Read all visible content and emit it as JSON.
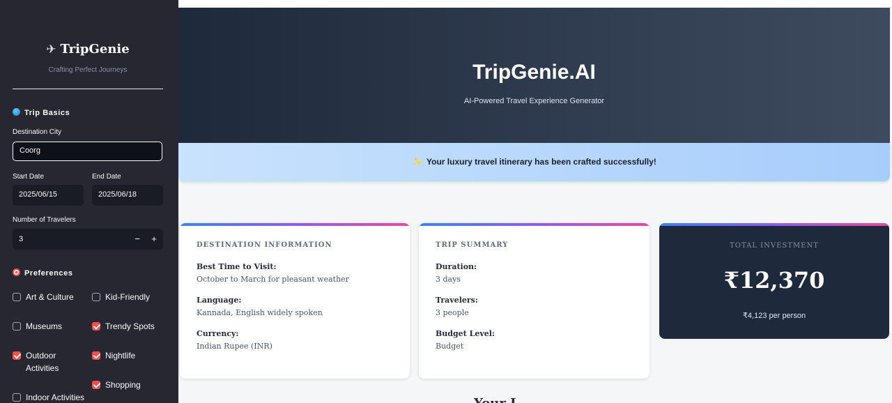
{
  "sidebar": {
    "brand": "TripGenie",
    "tagline": "Crafting Perfect Journeys",
    "trip_basics": {
      "heading": "Trip Basics",
      "destination_label": "Destination City",
      "destination_value": "Coorg",
      "start_label": "Start Date",
      "start_value": "2025/06/15",
      "end_label": "End Date",
      "end_value": "2025/06/18",
      "travelers_label": "Number of Travelers",
      "travelers_value": "3",
      "minus": "−",
      "plus": "+"
    },
    "preferences": {
      "heading": "Preferences",
      "options": [
        {
          "label": "Art & Culture",
          "checked": false
        },
        {
          "label": "Kid-Friendly",
          "checked": false
        },
        {
          "label": "Museums",
          "checked": false
        },
        {
          "label": "Trendy Spots",
          "checked": true
        },
        {
          "label": "Outdoor Activities",
          "checked": true
        },
        {
          "label": "Nightlife",
          "checked": true
        },
        {
          "label": "Shopping",
          "checked": true
        },
        {
          "label": "Indoor Activities",
          "checked": false
        }
      ]
    }
  },
  "hero": {
    "title": "TripGenie.AI",
    "subtitle": "AI-Powered Travel Experience Generator"
  },
  "banner": {
    "message": "Your luxury travel itinerary has been crafted successfully!"
  },
  "destination_card": {
    "title": "DESTINATION INFORMATION",
    "items": [
      {
        "label": "Best Time to Visit:",
        "value": "October to March for pleasant weather"
      },
      {
        "label": "Language:",
        "value": "Kannada, English widely spoken"
      },
      {
        "label": "Currency:",
        "value": "Indian Rupee (INR)"
      }
    ]
  },
  "summary_card": {
    "title": "TRIP SUMMARY",
    "items": [
      {
        "label": "Duration:",
        "value": "3 days"
      },
      {
        "label": "Travelers:",
        "value": "3 people"
      },
      {
        "label": "Budget Level:",
        "value": "Budget"
      }
    ]
  },
  "investment_card": {
    "title": "TOTAL INVESTMENT",
    "amount": "₹12,370",
    "per_person": "₹4,123 per person"
  },
  "next_section_heading_partial": "Your I",
  "colors": {
    "sidebar_bg": "#262730",
    "accent_red": "#ff4b4b",
    "hero_start": "#1e293b",
    "hero_end": "#3e4b5f",
    "banner_start": "#c9e2fd",
    "banner_end": "#a7cdfb",
    "investment_bg": "#1e293b"
  },
  "icons": {
    "brand": "airplane-icon",
    "trip_basics": "globe-icon",
    "preferences": "target-icon",
    "banner": "sparkles-icon"
  }
}
